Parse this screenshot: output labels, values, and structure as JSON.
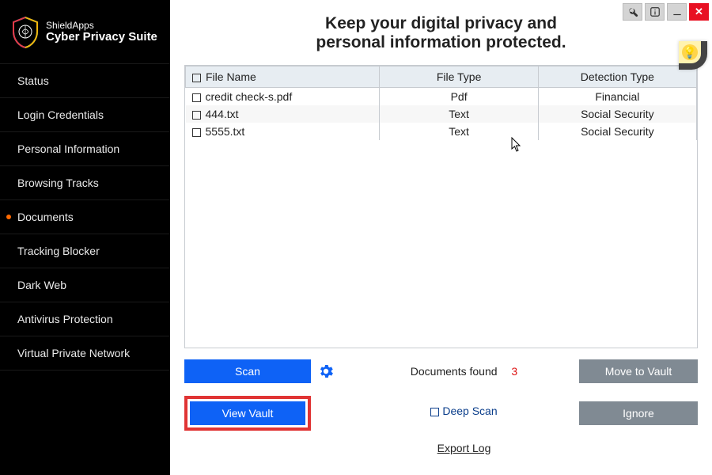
{
  "brand": {
    "line1": "ShieldApps",
    "line2": "Cyber Privacy Suite"
  },
  "sidebar": {
    "items": [
      {
        "label": "Status"
      },
      {
        "label": "Login Credentials"
      },
      {
        "label": "Personal Information"
      },
      {
        "label": "Browsing Tracks"
      },
      {
        "label": "Documents",
        "active": true
      },
      {
        "label": "Tracking Blocker"
      },
      {
        "label": "Dark Web"
      },
      {
        "label": "Antivirus Protection"
      },
      {
        "label": "Virtual Private Network"
      }
    ]
  },
  "headline": {
    "line1": "Keep your digital privacy and",
    "line2": "personal information protected."
  },
  "table": {
    "headers": {
      "c1": "File Name",
      "c2": "File Type",
      "c3": "Detection Type"
    },
    "rows": [
      {
        "name": "credit check-s.pdf",
        "type": "Pdf",
        "detect": "Financial"
      },
      {
        "name": "444.txt",
        "type": "Text",
        "detect": "Social Security"
      },
      {
        "name": "5555.txt",
        "type": "Text",
        "detect": "Social Security"
      }
    ]
  },
  "actions": {
    "scan": "Scan",
    "view_vault": "View Vault",
    "docs_found_label": "Documents found",
    "docs_found_count": "3",
    "move_to_vault": "Move to Vault",
    "deep_scan": "Deep Scan",
    "ignore": "Ignore",
    "export_log": "Export Log"
  }
}
